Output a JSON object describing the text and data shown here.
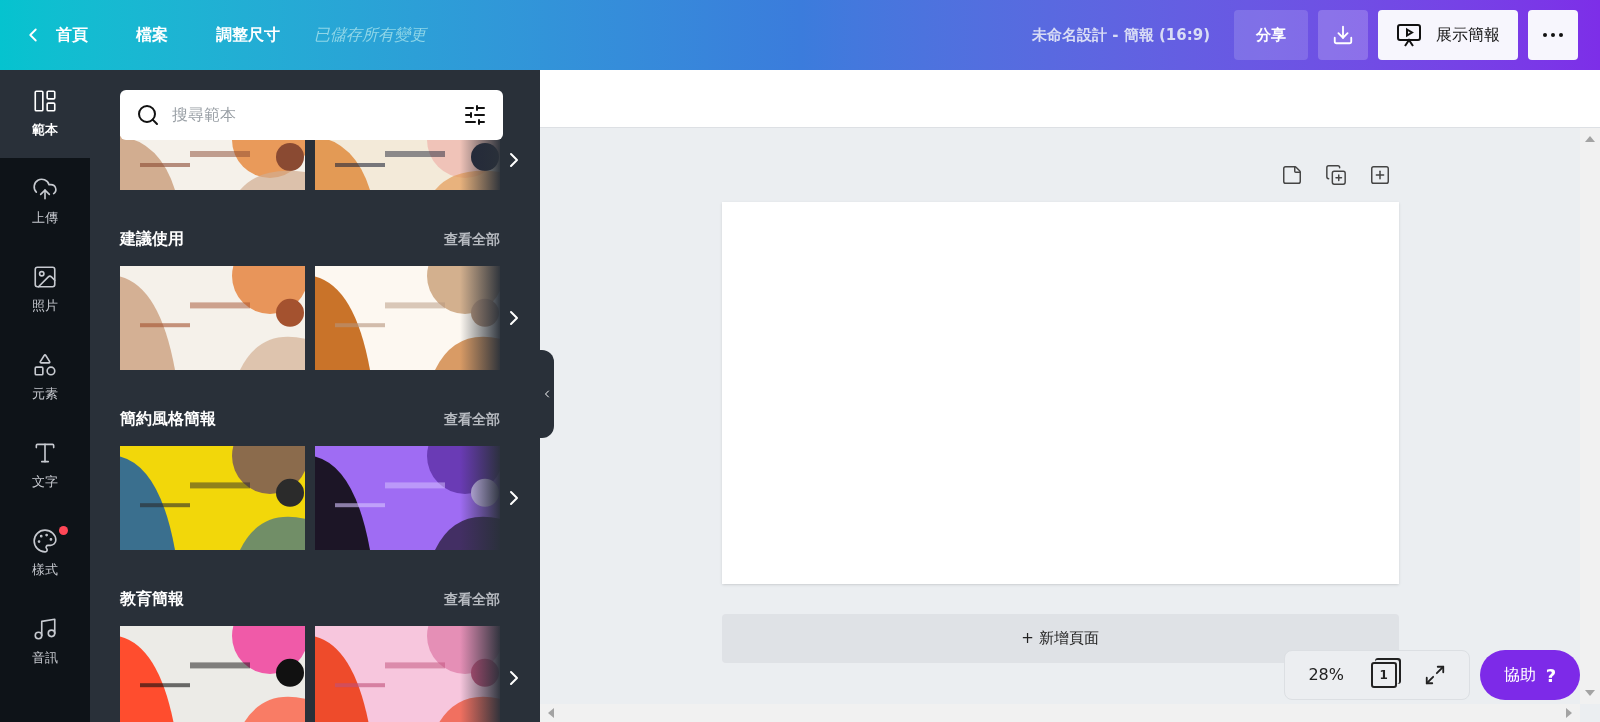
{
  "top_bar": {
    "back": {
      "label": "首頁"
    },
    "menu": [
      {
        "label": "檔案"
      },
      {
        "label": "調整尺寸"
      }
    ],
    "save_status": "已儲存所有變更",
    "design_title": "未命名設計 - 簡報 (16:9)",
    "share": "分享",
    "present": "展示簡報"
  },
  "sidebar": {
    "items": [
      {
        "label": "範本",
        "kind": "template",
        "selected": true,
        "notification": false
      },
      {
        "label": "上傳",
        "kind": "upload",
        "selected": false,
        "notification": false
      },
      {
        "label": "照片",
        "selected": false,
        "notification": false
      },
      {
        "label": "元素",
        "kind": "elements",
        "selected": false,
        "notification": false
      },
      {
        "label": "文字",
        "kind": "text",
        "selected": false,
        "notification": false
      },
      {
        "label": "樣式",
        "kind": "styles",
        "selected": false,
        "notification": true
      },
      {
        "label": "音訊",
        "kind": "audio",
        "selected": false,
        "notification": false
      }
    ]
  },
  "panel": {
    "search": {
      "placeholder": "搜尋範本"
    },
    "sections": [
      {
        "title": "建議使用",
        "see_all": "查看全部"
      },
      {
        "title": "簡約風格簡報",
        "see_all": "查看全部"
      },
      {
        "title": "教育簡報",
        "see_all": "查看全部"
      }
    ]
  },
  "canvas": {
    "add_page": "+ 新增頁面",
    "zoom": "28%",
    "page_count": "1",
    "help": {
      "label": "協助",
      "icon": "?"
    }
  }
}
